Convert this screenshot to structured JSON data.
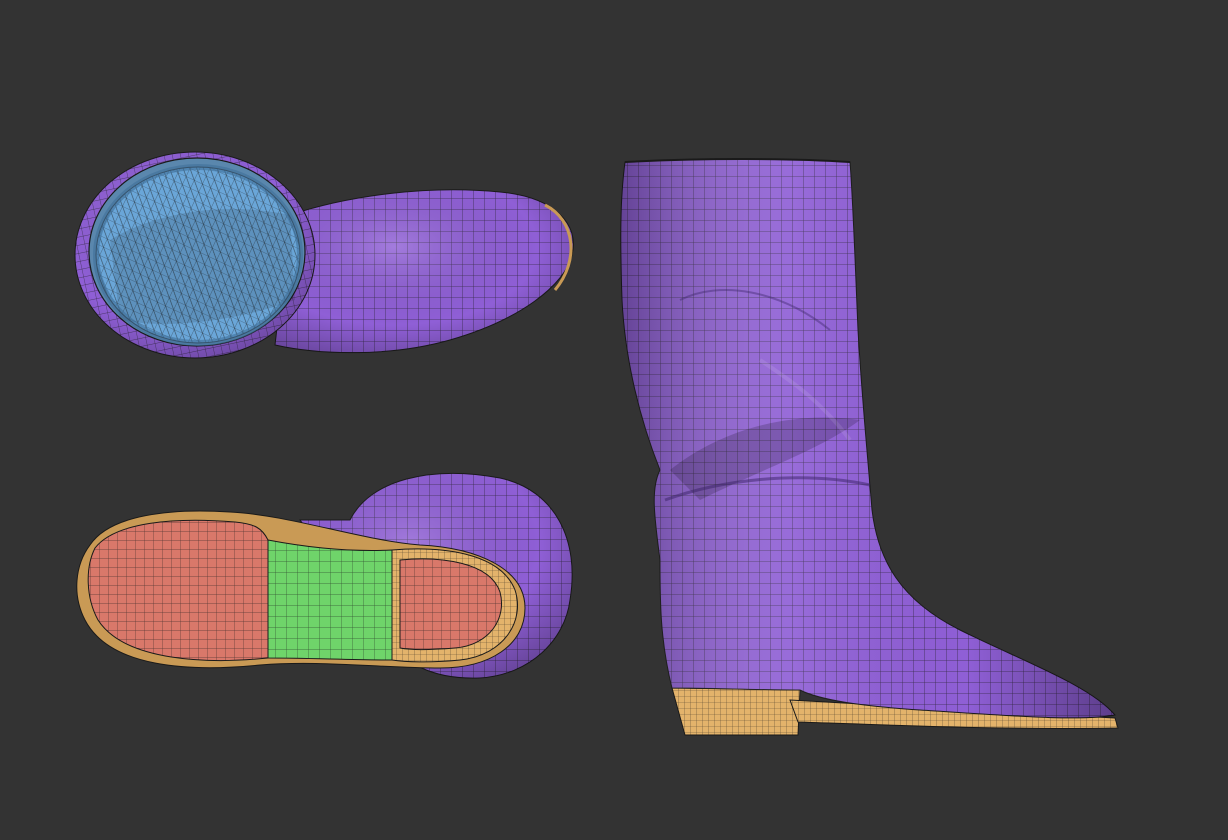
{
  "scene": {
    "background": "#333333",
    "views": [
      {
        "name": "top-view",
        "parts": [
          "shaft",
          "interior-lining"
        ]
      },
      {
        "name": "bottom-view",
        "parts": [
          "upper",
          "sole-forefoot",
          "sole-shank",
          "heel-cap",
          "welt"
        ]
      },
      {
        "name": "side-view",
        "parts": [
          "shaft",
          "foot",
          "heel",
          "welt"
        ]
      }
    ],
    "colors": {
      "upper": "#8f5fd6",
      "upper_dark": "#5d3a9c",
      "lining": "#6aa6d8",
      "lining_dark": "#3f6f99",
      "sole_forefoot": "#d9786a",
      "sole_shank": "#6fd46a",
      "heel": "#e3b36b",
      "wire": "#1a1a1a"
    }
  }
}
